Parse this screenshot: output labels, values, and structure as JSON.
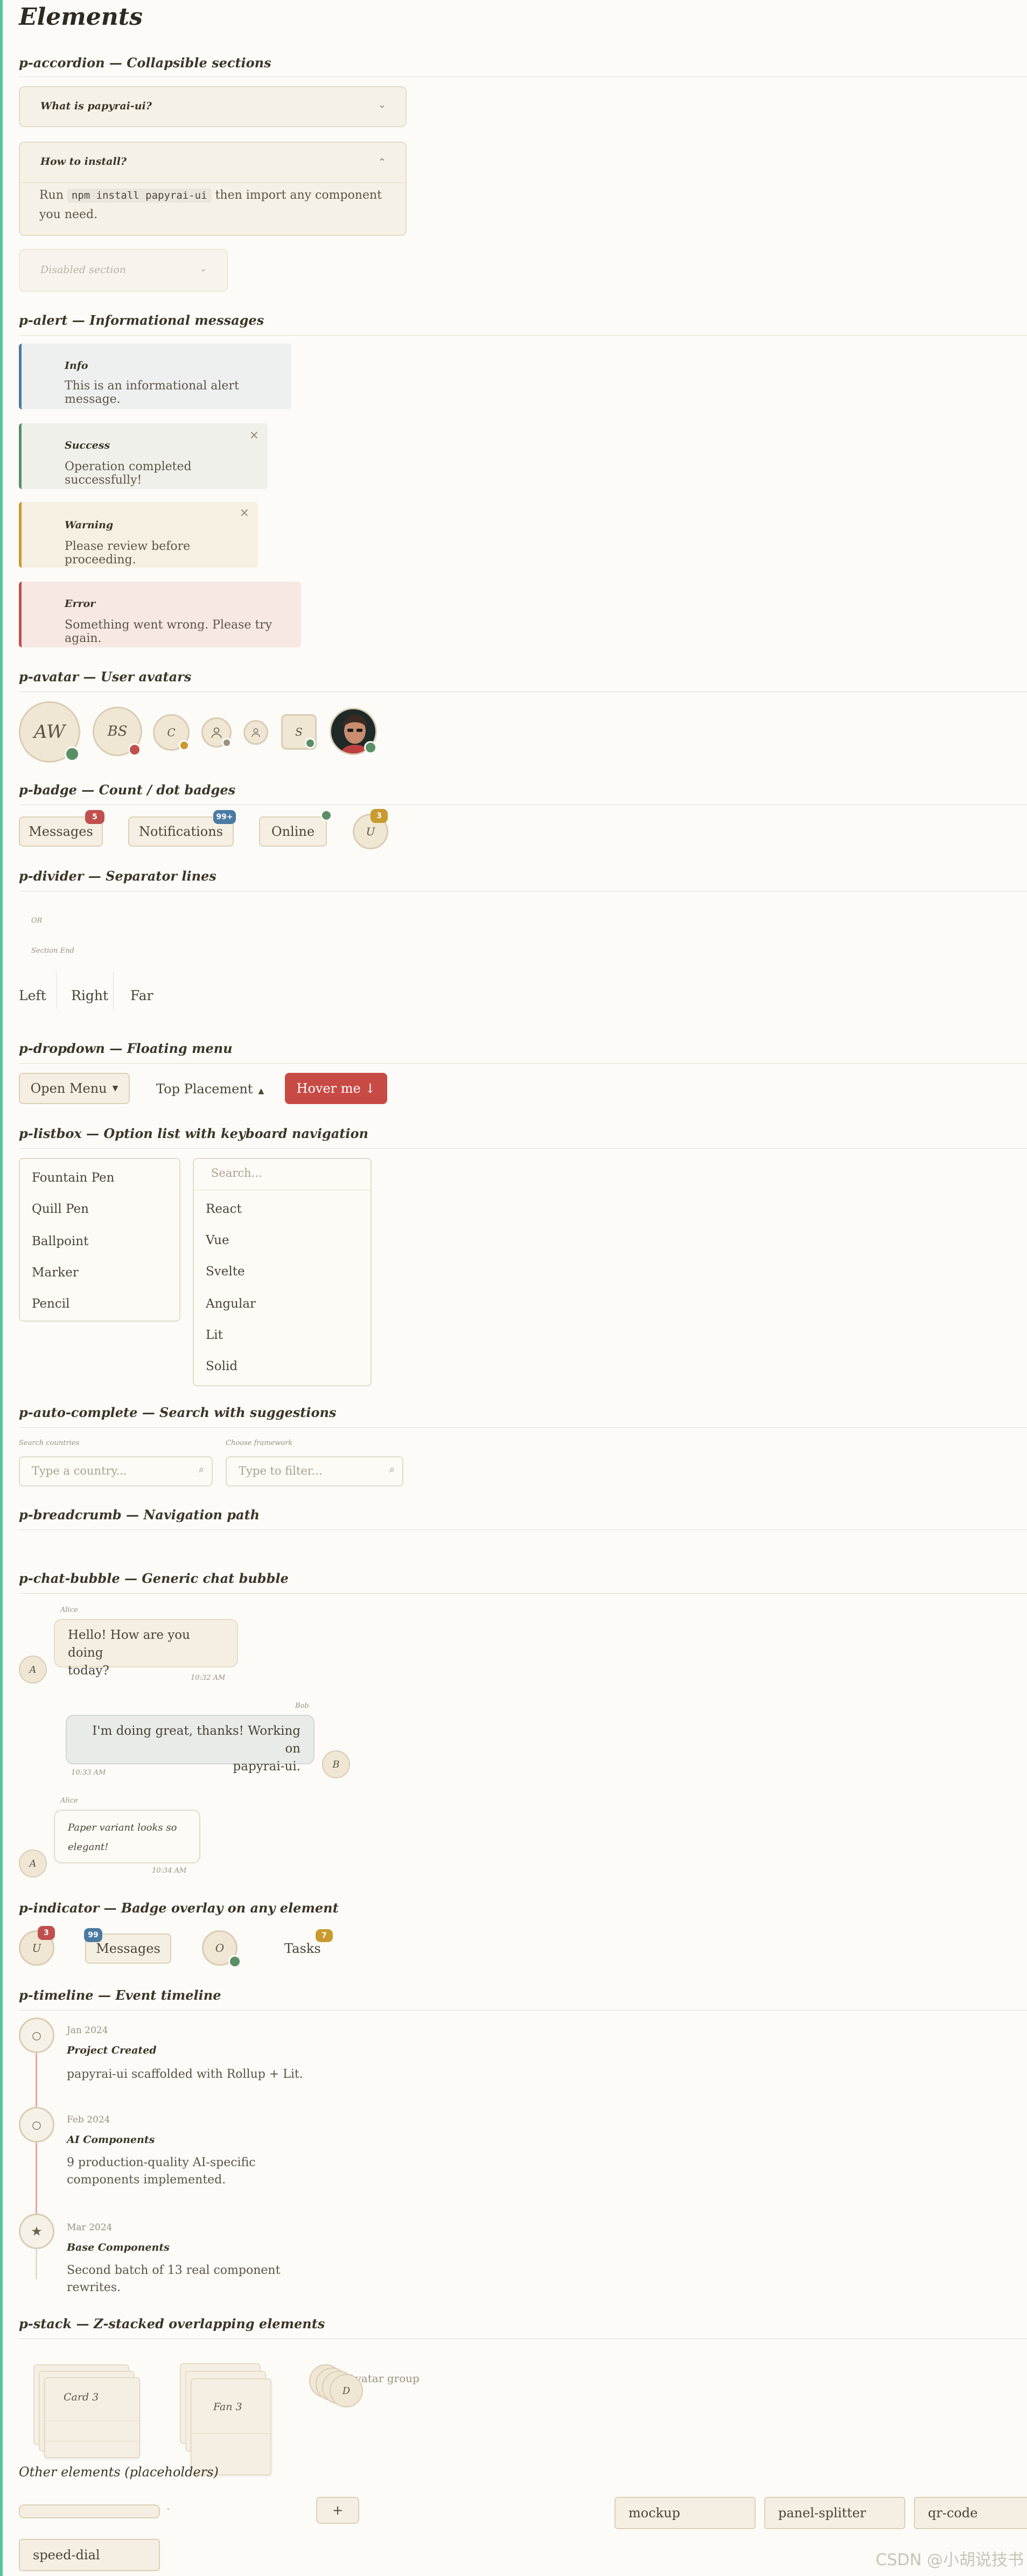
{
  "page": {
    "title": "Elements"
  },
  "accordion": {
    "heading": "p-accordion — Collapsible sections",
    "items": [
      {
        "title": "What is papyrai-ui?"
      },
      {
        "title": "How to install?",
        "body_pre": "Run",
        "code": "npm install papyrai-ui",
        "body_post": "then import any component",
        "body_line2": "you need."
      },
      {
        "title": "Disabled section"
      }
    ]
  },
  "alert": {
    "heading": "p-alert — Informational messages",
    "items": [
      {
        "title": "Info",
        "message": "This is an informational alert message.",
        "color": "#4a7ba3"
      },
      {
        "title": "Success",
        "message": "Operation completed successfully!",
        "color": "#5a8f66"
      },
      {
        "title": "Warning",
        "message": "Please review before proceeding.",
        "color": "#c99a2e"
      },
      {
        "title": "Error",
        "message": "Something went wrong. Please try again.",
        "color": "#c0504d"
      }
    ]
  },
  "avatar": {
    "heading": "p-avatar — User avatars",
    "items": [
      {
        "initials": "AW",
        "status": "#5a8f66"
      },
      {
        "initials": "BS",
        "status": "#c0504d"
      },
      {
        "initials": "C",
        "status": "#c99a2e"
      },
      {
        "initials": "",
        "status": "#9a9080",
        "icon": "user-icon"
      },
      {
        "initials": "",
        "icon": "user-icon"
      },
      {
        "initials": "S",
        "status": "#5a8f66"
      },
      {
        "initials": "",
        "status": "#5a8f66",
        "icon": "photo"
      }
    ]
  },
  "badge": {
    "heading": "p-badge — Count / dot badges",
    "items": [
      {
        "label": "Messages",
        "count": "5",
        "color": "#c0504d"
      },
      {
        "label": "Notifications",
        "count": "99+",
        "color": "#4a7ba3"
      },
      {
        "label": "Online",
        "count": "",
        "color": "#5a8f66"
      },
      {
        "label": "U",
        "count": "3",
        "color": "#c99a2e"
      }
    ]
  },
  "divider": {
    "heading": "p-divider — Separator lines",
    "or": "OR",
    "section_end": "Section End",
    "inline": [
      "Left",
      "Right",
      "Far"
    ]
  },
  "dropdown": {
    "heading": "p-dropdown — Floating menu",
    "open_menu": "Open Menu",
    "top_placement": "Top Placement",
    "hover": "Hover me ↓"
  },
  "listbox": {
    "heading": "p-listbox — Option list with keyboard navigation",
    "list1": [
      "Fountain Pen",
      "Quill Pen",
      "Ballpoint",
      "Marker",
      "Pencil"
    ],
    "search_placeholder": "Search...",
    "list2": [
      "React",
      "Vue",
      "Svelte",
      "Angular",
      "Lit",
      "Solid"
    ]
  },
  "autocomplete": {
    "heading": "p-auto-complete — Search with suggestions",
    "field1_label": "Search countries",
    "field1_placeholder": "Type a country...",
    "field2_label": "Choose framework",
    "field2_placeholder": "Type to filter..."
  },
  "breadcrumb": {
    "heading": "p-breadcrumb — Navigation path"
  },
  "chat": {
    "heading": "p-chat-bubble — Generic chat bubble",
    "messages": [
      {
        "sender": "Alice",
        "avatar": "A",
        "line1": "Hello! How are you doing",
        "line2": "today?",
        "time": "10:32 AM"
      },
      {
        "sender": "Bob",
        "avatar": "B",
        "line1": "I'm doing great, thanks! Working on",
        "line2": "papyrai-ui.",
        "time": "10:33 AM"
      },
      {
        "sender": "Alice",
        "avatar": "A",
        "line1": "Paper variant looks so",
        "line2": "elegant!",
        "time": "10:34 AM"
      }
    ]
  },
  "indicator": {
    "heading": "p-indicator — Badge overlay on any element",
    "avatar_u": "U",
    "count_u": "3",
    "messages": "Messages",
    "count_msg": "99",
    "avatar_o": "O",
    "tasks": "Tasks",
    "count_tasks": "7"
  },
  "timeline": {
    "heading": "p-timeline — Event timeline",
    "events": [
      {
        "date": "Jan 2024",
        "title": "Project Created",
        "line1": "papyrai-ui scaffolded with Rollup + Lit.",
        "line2": "",
        "mark": "○"
      },
      {
        "date": "Feb 2024",
        "title": "AI Components",
        "line1": "9 production-quality AI-specific",
        "line2": "components implemented.",
        "mark": "○"
      },
      {
        "date": "Mar 2024",
        "title": "Base Components",
        "line1": "Second batch of 13 real component",
        "line2": "rewrites.",
        "mark": "★"
      }
    ]
  },
  "stack": {
    "heading": "p-stack — Z-stacked overlapping elements",
    "card_label": "Card 3",
    "fan_label": "Fan 3",
    "avatar_group_label": "Avatar group",
    "avatar_letter": "D"
  },
  "other": {
    "heading": "Other elements (placeholders)",
    "dash": "-",
    "plus": "+",
    "mockup": "mockup",
    "panel_splitter": "panel-splitter",
    "qr_code": "qr-code",
    "speed_dial": "speed-dial"
  },
  "watermark": "CSDN @小胡说技书"
}
